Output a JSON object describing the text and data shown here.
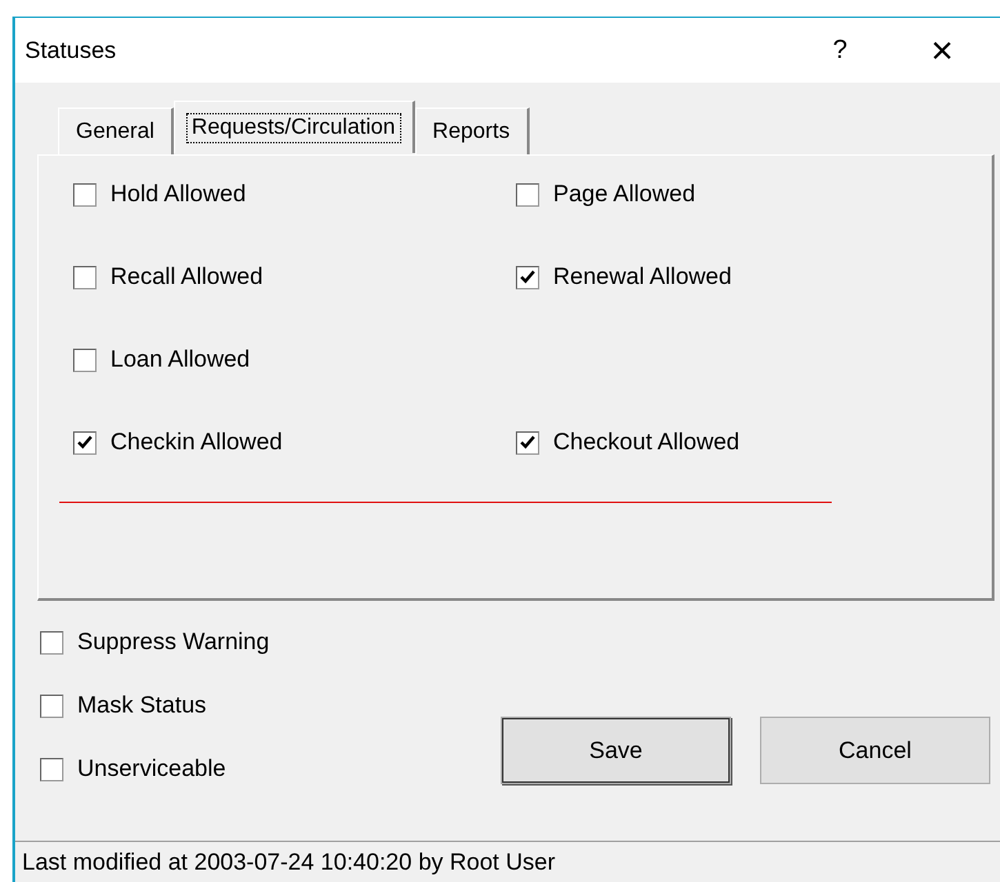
{
  "window": {
    "title": "Statuses",
    "help": "?",
    "close": "×"
  },
  "tabs": [
    {
      "label": "General",
      "selected": false
    },
    {
      "label": "Requests/Circulation",
      "selected": true
    },
    {
      "label": "Reports",
      "selected": false
    }
  ],
  "panel": {
    "rows": [
      {
        "left": {
          "label": "Hold Allowed",
          "checked": false
        },
        "right": {
          "label": "Page Allowed",
          "checked": false
        }
      },
      {
        "left": {
          "label": "Recall Allowed",
          "checked": false
        },
        "right": {
          "label": "Renewal Allowed",
          "checked": true
        }
      },
      {
        "left": {
          "label": "Loan Allowed",
          "checked": false
        }
      },
      {
        "left": {
          "label": "Checkin Allowed",
          "checked": true
        },
        "right": {
          "label": "Checkout Allowed",
          "checked": true
        }
      }
    ]
  },
  "options": [
    {
      "label": "Suppress Warning",
      "checked": false
    },
    {
      "label": "Mask Status",
      "checked": false
    },
    {
      "label": "Unserviceable",
      "checked": false
    }
  ],
  "buttons": [
    "Save",
    "Cancel"
  ],
  "status_bar": "Last modified at 2003-07-24 10:40:20 by Root User"
}
